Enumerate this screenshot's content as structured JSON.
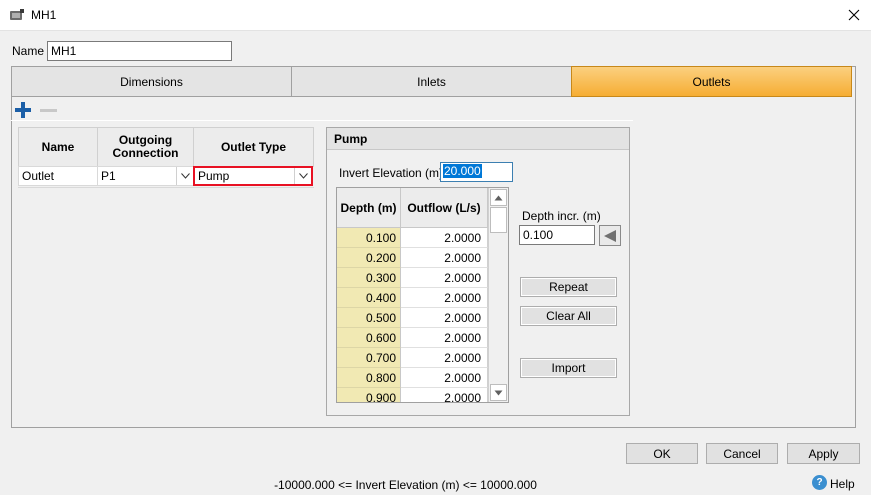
{
  "window": {
    "title": "MH1",
    "close_glyph": "✕",
    "app_icon": "manhole-icon"
  },
  "name_field": {
    "label": "Name",
    "value": "MH1"
  },
  "tabs": [
    {
      "label": "Dimensions",
      "active": false
    },
    {
      "label": "Inlets",
      "active": false
    },
    {
      "label": "Outlets",
      "active": true
    }
  ],
  "toolbar": {
    "add_icon": "plus-icon",
    "remove_icon": "minus-icon"
  },
  "outlets_grid": {
    "headers": {
      "name": "Name",
      "connection_line1": "Outgoing",
      "connection_line2": "Connection",
      "type": "Outlet Type"
    },
    "rows": [
      {
        "name": "Outlet",
        "connection": "P1",
        "type": "Pump"
      }
    ]
  },
  "pump": {
    "title": "Pump",
    "invert_label": "Invert Elevation (m)",
    "invert_value": "20.000",
    "table": {
      "depth_header": "Depth (m)",
      "outflow_header": "Outflow (L/s)",
      "rows": [
        {
          "depth": "0.100",
          "outflow": "2.0000"
        },
        {
          "depth": "0.200",
          "outflow": "2.0000"
        },
        {
          "depth": "0.300",
          "outflow": "2.0000"
        },
        {
          "depth": "0.400",
          "outflow": "2.0000"
        },
        {
          "depth": "0.500",
          "outflow": "2.0000"
        },
        {
          "depth": "0.600",
          "outflow": "2.0000"
        },
        {
          "depth": "0.700",
          "outflow": "2.0000"
        },
        {
          "depth": "0.800",
          "outflow": "2.0000"
        },
        {
          "depth": "0.900",
          "outflow": "2.0000"
        }
      ]
    },
    "depth_incr_label": "Depth incr. (m)",
    "depth_incr_value": "0.100",
    "repeat_label": "Repeat",
    "clear_all_label": "Clear All",
    "import_label": "Import"
  },
  "footer": {
    "ok_label": "OK",
    "cancel_label": "Cancel",
    "apply_label": "Apply"
  },
  "status": {
    "text": "-10000.000 <= Invert Elevation (m) <= 10000.000",
    "help_label": "Help",
    "help_glyph": "?"
  },
  "colors": {
    "active_tab": "#f6ad33",
    "depth_column": "#f1e9b3",
    "selection": "#0078d7",
    "invalid_border": "#e81123",
    "add_icon": "#1b5ea6"
  }
}
